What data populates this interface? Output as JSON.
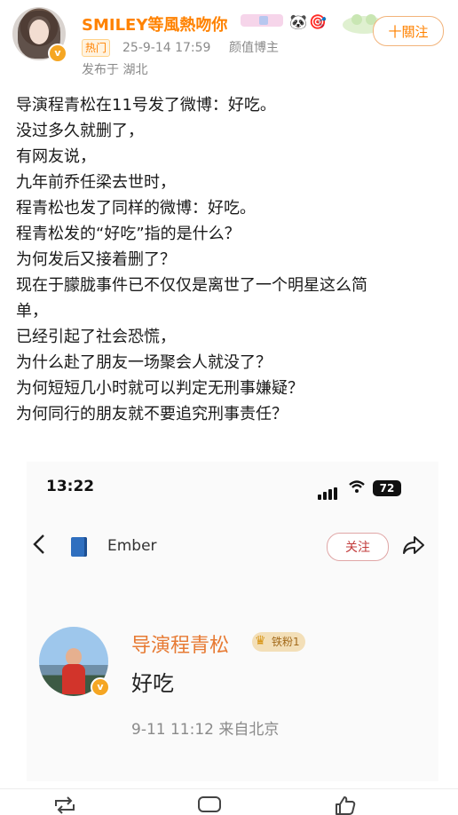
{
  "post": {
    "username": "SMILEY等風熱吻你",
    "emojis": [
      "🐼",
      "🎯"
    ],
    "tag": "热门",
    "timestamp": "25-9-14 17:59",
    "role": "颜值博主",
    "location": "发布于 湖北",
    "follow_label": "十關注",
    "lines": [
      "导演程青松在11号发了微博：好吃。",
      "没过多久就删了，",
      "有网友说，",
      "九年前乔任梁去世时，",
      "程青松也发了同样的微博：好吃。",
      "程青松发的“好吃”指的是什么？",
      "为何发后又接着删了？",
      "现在于朦胧事件已不仅仅是离世了一个明星这么简",
      "单，",
      "已经引起了社会恐慌，",
      "为什么赴了朋友一场聚会人就没了？",
      "为何短短几小时就可以判定无刑事嫌疑？",
      "为何同行的朋友就不要追究刑事责任？"
    ]
  },
  "screenshot": {
    "time": "13:22",
    "battery": "72",
    "app_title": "Ember",
    "follow_label": "关注",
    "author": "导演程青松",
    "fan_badge": "铁粉1",
    "post_text": "好吃",
    "post_meta": "9-11 11:12  来自北京"
  },
  "colors": {
    "username": "#ff8200",
    "author": "#e77a33",
    "meta_gray": "#8a8a8a"
  }
}
